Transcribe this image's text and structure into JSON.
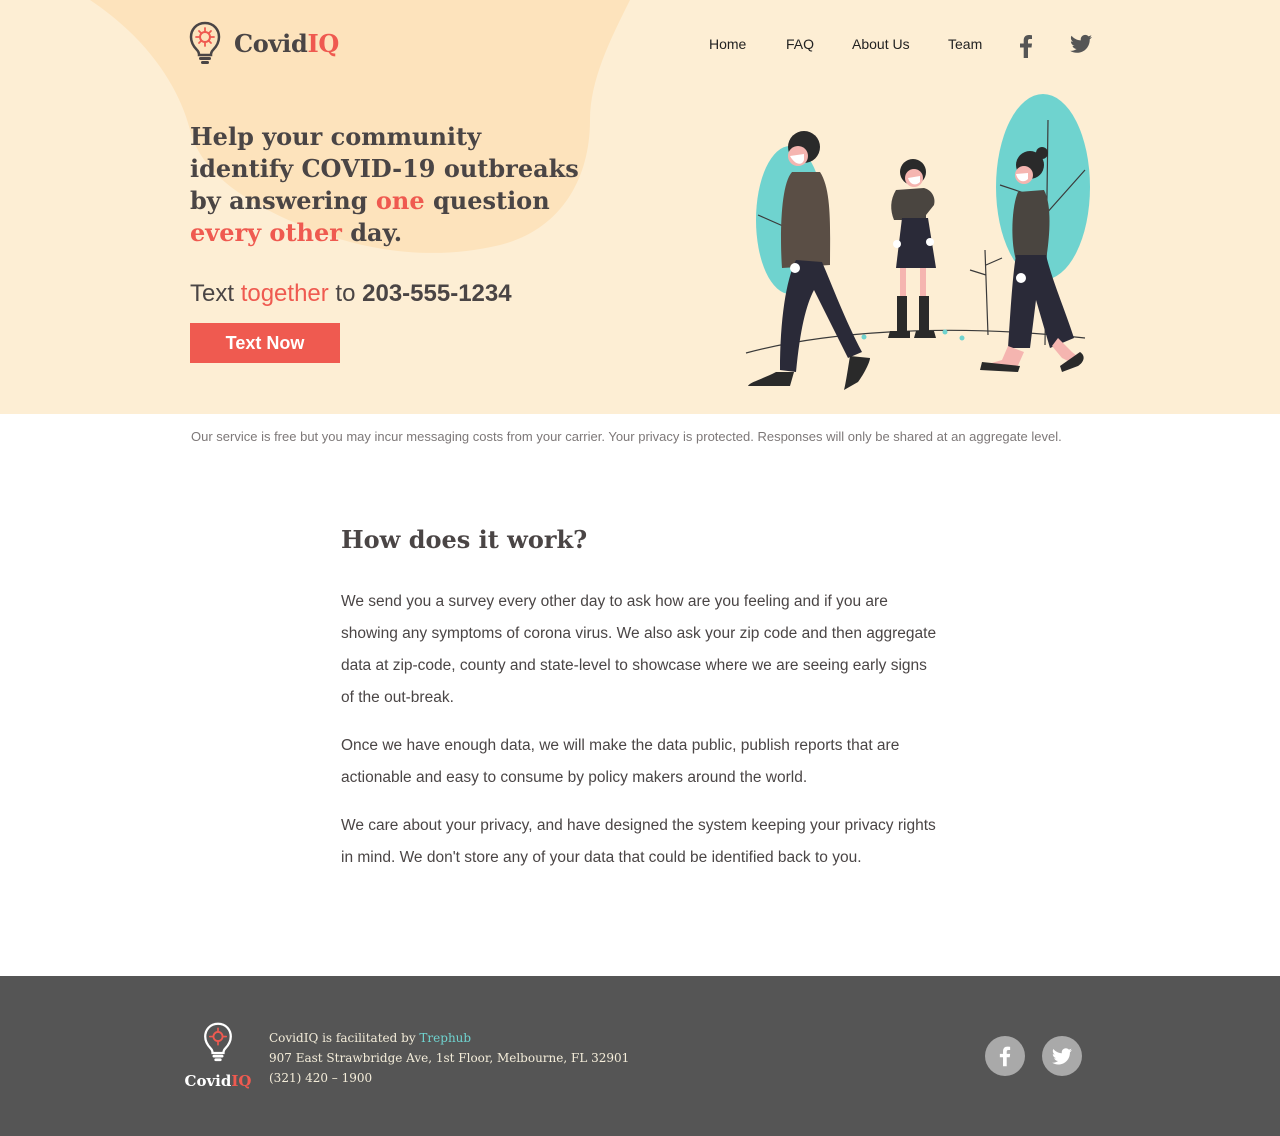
{
  "brand": {
    "name_part1": "Covid",
    "name_part2": "IQ",
    "accent_color": "#ef5a50",
    "teal_color": "#6fd3cf",
    "hero_bg": "#fdeed4"
  },
  "nav": {
    "items": [
      {
        "label": "Home"
      },
      {
        "label": "FAQ"
      },
      {
        "label": "About Us"
      },
      {
        "label": "Team"
      }
    ],
    "social_icons": [
      "facebook-icon",
      "twitter-icon"
    ]
  },
  "hero": {
    "headline_1": "Help your community identify COVID-19 outbreaks by answering ",
    "headline_hl1": "one",
    "headline_2": " question ",
    "headline_hl2": "every other",
    "headline_3": " day.",
    "text_prefix": "Text ",
    "text_keyword": "together",
    "text_mid": " to ",
    "text_number": "203-555-1234",
    "cta_label": "Text Now"
  },
  "disclaimer": "Our service is free but you may incur messaging costs from your carrier. Your privacy is protected. Responses will only be shared at an aggregate level.",
  "how": {
    "title": "How does it work?",
    "paragraphs": [
      "We send you a survey every other day to ask how are you feeling and if you are showing any symptoms of corona virus. We also ask your zip code and then aggregate data at zip-code, county and state-level to showcase where we are seeing early signs of the out-break.",
      "Once we have enough data, we will make the data public, publish reports that are actionable and easy to consume by policy makers around the world.",
      "We care about your privacy, and have designed the system keeping your privacy rights in mind. We don't store any of your data that could be identified back to you."
    ]
  },
  "footer": {
    "facilitated_prefix": "CovidIQ is facilitated by ",
    "facilitator": "Trephub",
    "address": "907 East Strawbridge Ave, 1st Floor, Melbourne, FL 32901",
    "phone": "(321) 420 – 1900",
    "social_icons": [
      "facebook-icon",
      "twitter-icon"
    ]
  }
}
